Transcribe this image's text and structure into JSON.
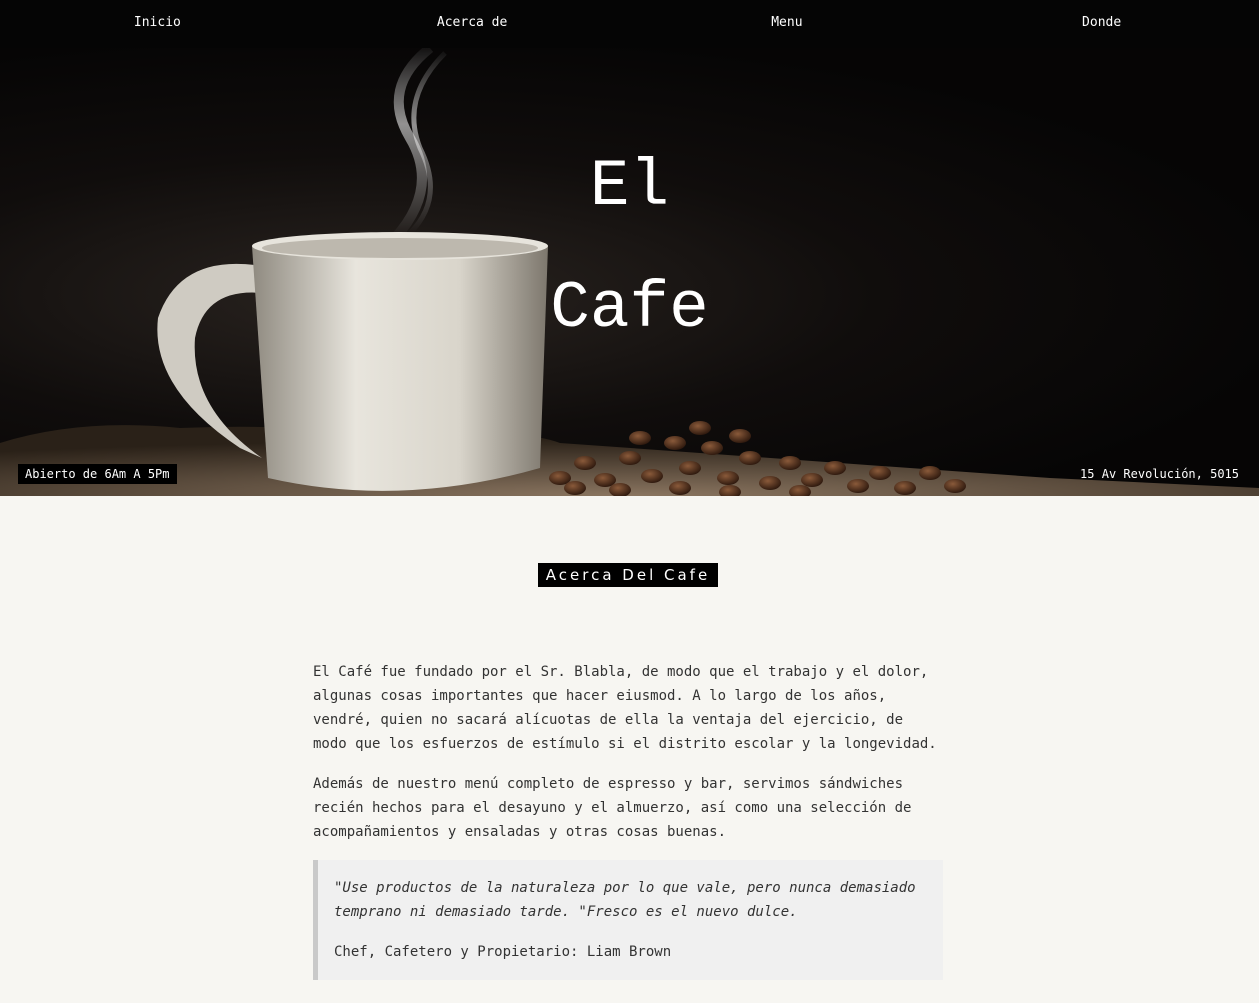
{
  "nav": {
    "items": [
      {
        "label": "Inicio"
      },
      {
        "label": "Acerca de"
      },
      {
        "label": "Menu"
      },
      {
        "label": "Donde"
      }
    ]
  },
  "hero": {
    "title_line1": "El",
    "title_line2": "Cafe",
    "hours": "Abierto de 6Am A 5Pm",
    "address": "15 Av Revolución, 5015"
  },
  "about": {
    "heading": "Acerca Del Cafe",
    "paragraph1": "El Café fue fundado por el Sr. Blabla, de modo que el trabajo y el dolor, algunas cosas importantes que hacer eiusmod. A lo largo de los años, vendré, quien no sacará alícuotas de ella la ventaja del ejercicio, de modo que los esfuerzos de estímulo si el distrito escolar y la longevidad.",
    "paragraph2": "Además de nuestro menú completo de espresso y bar, servimos sándwiches recién hechos para el desayuno y el almuerzo, así como una selección de acompañamientos y ensaladas y otras cosas buenas.",
    "quote": "\"Use productos de la naturaleza por lo que vale, pero nunca demasiado temprano ni demasiado tarde. \"Fresco es el nuevo dulce.",
    "quote_author": "Chef, Cafetero y Propietario: Liam Brown"
  },
  "colors": {
    "nav_bg": "#050505",
    "page_bg": "#f7f6f2",
    "heading_bg": "#000000",
    "quote_bg": "#f0f0f0"
  }
}
